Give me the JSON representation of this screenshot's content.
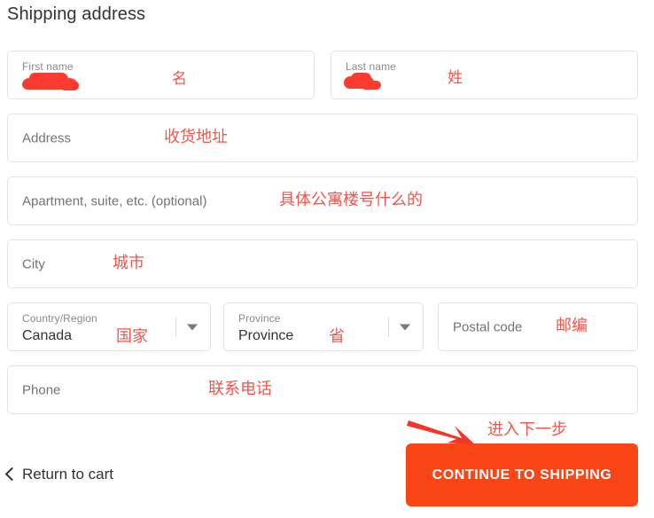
{
  "page": {
    "title": "Shipping address",
    "accent_color": "#fa4616",
    "annotation_color": "#f4554a",
    "field_border_color": "#e4e4e4"
  },
  "form": {
    "first_name": {
      "label": "First name",
      "value": "",
      "redacted": true,
      "annotation": "名"
    },
    "last_name": {
      "label": "Last name",
      "value": "",
      "redacted": true,
      "annotation": "姓"
    },
    "address": {
      "label": "Address",
      "value": "",
      "annotation": "收货地址"
    },
    "apartment": {
      "label": "Apartment, suite, etc. (optional)",
      "value": "",
      "annotation": "具体公寓楼号什么的"
    },
    "city": {
      "label": "City",
      "value": "",
      "annotation": "城市"
    },
    "country": {
      "label": "Country/Region",
      "value": "Canada",
      "annotation": "国家",
      "icon": "chevron-down-icon"
    },
    "province": {
      "label": "Province",
      "value": "Province",
      "annotation": "省",
      "icon": "chevron-down-icon"
    },
    "postal_code": {
      "label": "Postal code",
      "value": "",
      "annotation": "邮编"
    },
    "phone": {
      "label": "Phone",
      "value": "",
      "annotation": "联系电话"
    }
  },
  "footer": {
    "return_link": "Return to cart",
    "return_icon": "chevron-left-icon",
    "continue_button": "CONTINUE TO SHIPPING",
    "continue_annotation": "进入下一步",
    "arrow_icon": "arrow-pointing-to-button"
  }
}
